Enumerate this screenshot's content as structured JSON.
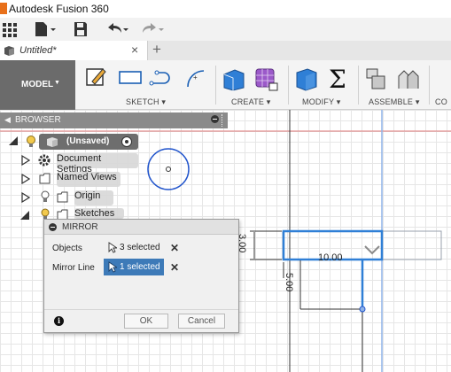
{
  "window": {
    "title": "Autodesk Fusion 360"
  },
  "tab": {
    "label": "Untitled*",
    "close_glyph": "×",
    "new_glyph": "+"
  },
  "ribbon": {
    "workspace": "MODEL",
    "groups": [
      {
        "label": "SKETCH"
      },
      {
        "label": "CREATE"
      },
      {
        "label": "MODIFY"
      },
      {
        "label": "ASSEMBLE"
      },
      {
        "label": "CO"
      }
    ]
  },
  "browser": {
    "title": "BROWSER",
    "root": "(Unsaved)",
    "items": [
      {
        "label": "Document Settings",
        "icon": "gear-icon"
      },
      {
        "label": "Named Views",
        "icon": "folder-icon"
      },
      {
        "label": "Origin",
        "icon": "folder-icon"
      },
      {
        "label": "Sketches",
        "icon": "folder-icon"
      }
    ]
  },
  "mirror_dialog": {
    "title": "MIRROR",
    "rows": [
      {
        "label": "Objects",
        "value": "3 selected",
        "active": false
      },
      {
        "label": "Mirror Line",
        "value": "1 selected",
        "active": true
      }
    ],
    "ok": "OK",
    "cancel": "Cancel"
  },
  "sketch": {
    "dimensions": [
      "10.00",
      "3.00",
      "5.00"
    ]
  },
  "colors": {
    "selection_blue": "#3d7ab8",
    "sketch_blue": "#2255cc",
    "workspace_gray": "#6b6b6b"
  }
}
